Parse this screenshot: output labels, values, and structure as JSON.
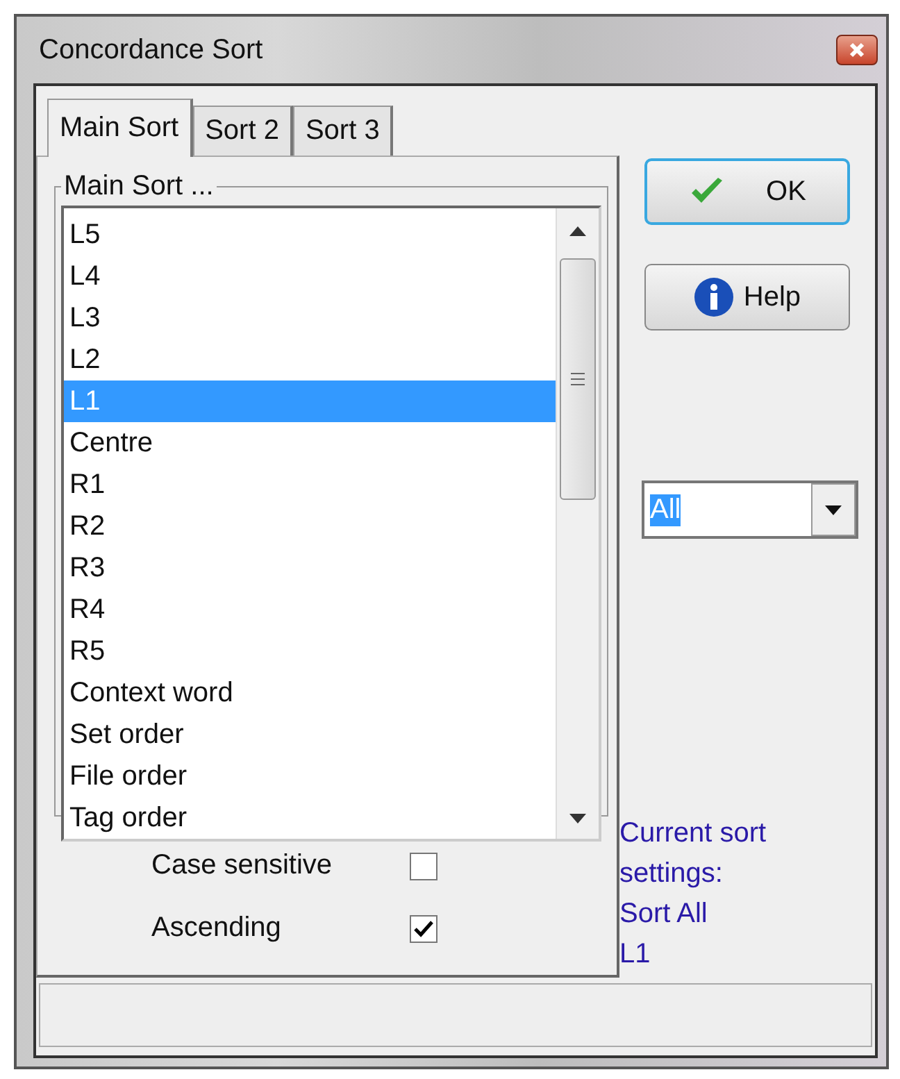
{
  "window": {
    "title": "Concordance Sort"
  },
  "tabs": [
    {
      "label": "Main Sort",
      "selected": true
    },
    {
      "label": "Sort 2",
      "selected": false
    },
    {
      "label": "Sort 3",
      "selected": false
    }
  ],
  "group": {
    "title": "Main Sort ..."
  },
  "sort_list": [
    {
      "label": "L5",
      "selected": false
    },
    {
      "label": "L4",
      "selected": false
    },
    {
      "label": "L3",
      "selected": false
    },
    {
      "label": "L2",
      "selected": false
    },
    {
      "label": "L1",
      "selected": true
    },
    {
      "label": "Centre",
      "selected": false
    },
    {
      "label": "R1",
      "selected": false
    },
    {
      "label": "R2",
      "selected": false
    },
    {
      "label": "R3",
      "selected": false
    },
    {
      "label": "R4",
      "selected": false
    },
    {
      "label": "R5",
      "selected": false
    },
    {
      "label": "Context word",
      "selected": false
    },
    {
      "label": "Set order",
      "selected": false
    },
    {
      "label": "File order",
      "selected": false
    },
    {
      "label": "Tag order",
      "selected": false
    }
  ],
  "options": [
    {
      "label": "Case sensitive",
      "checked": false
    },
    {
      "label": "Ascending",
      "checked": true
    }
  ],
  "buttons": [
    {
      "kind": "ok",
      "label": "OK",
      "focused": true
    },
    {
      "kind": "help",
      "label": "Help",
      "focused": false
    }
  ],
  "scope_combo": {
    "value": "All"
  },
  "current_settings": [
    "Current sort settings:",
    "Sort All",
    "L1"
  ]
}
